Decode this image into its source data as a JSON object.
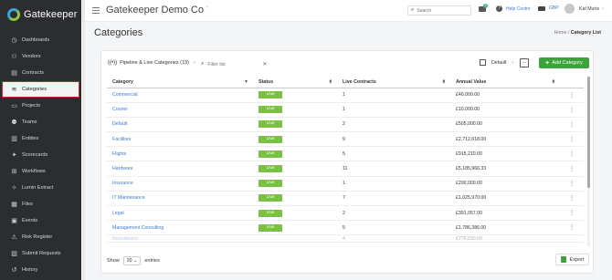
{
  "app": {
    "logo_text": "Gatekeeper"
  },
  "sidebar": {
    "items": [
      {
        "label": "Dashboards",
        "icon": "gauge-icon",
        "glyph": "◷"
      },
      {
        "label": "Vendors",
        "icon": "vendors-icon",
        "glyph": "⚇"
      },
      {
        "label": "Contracts",
        "icon": "document-icon",
        "glyph": "▤"
      },
      {
        "label": "Categories",
        "icon": "layers-icon",
        "glyph": "≋",
        "active": true
      },
      {
        "label": "Projects",
        "icon": "folder-icon",
        "glyph": "▭"
      },
      {
        "label": "Teams",
        "icon": "users-icon",
        "glyph": "⚉"
      },
      {
        "label": "Entities",
        "icon": "building-icon",
        "glyph": "▥"
      },
      {
        "label": "Scorecards",
        "icon": "star-icon",
        "glyph": "✦"
      },
      {
        "label": "Workflows",
        "icon": "workflow-icon",
        "glyph": "⊞"
      },
      {
        "label": "Lumin Extract",
        "icon": "sparkle-icon",
        "glyph": "✧"
      },
      {
        "label": "Files",
        "icon": "file-icon",
        "glyph": "▦"
      },
      {
        "label": "Events",
        "icon": "calendar-icon",
        "glyph": "▣"
      },
      {
        "label": "Risk Register",
        "icon": "warning-icon",
        "glyph": "⚠"
      },
      {
        "label": "Submit Requests",
        "icon": "submit-icon",
        "glyph": "▧"
      },
      {
        "label": "History",
        "icon": "history-icon",
        "glyph": "↺"
      }
    ]
  },
  "topbar": {
    "org": "Gatekeeper Demo Co",
    "search_placeholder": "Search",
    "mail_count": "3",
    "help": "Help Centre",
    "currency": "GBP",
    "user": "Kat Murie"
  },
  "page": {
    "title": "Categories",
    "breadcrumb_home": "Home",
    "breadcrumb_sep": "/",
    "breadcrumb_current": "Category List"
  },
  "toolbar": {
    "pipeline": "Pipeline & Live Categories (13)",
    "filter_placeholder": "Filter list",
    "view": "Default",
    "add_label": "Add Category"
  },
  "table": {
    "columns": [
      "Category",
      "Status",
      "Live Contracts",
      "Annual Value"
    ],
    "rows": [
      {
        "category": "Commercial",
        "status": "Live",
        "contracts": "1",
        "value": "£40,000.00"
      },
      {
        "category": "Courier",
        "status": "Live",
        "contracts": "1",
        "value": "£10,000.00"
      },
      {
        "category": "Default",
        "status": "Live",
        "contracts": "2",
        "value": "£505,000.00"
      },
      {
        "category": "Facilities",
        "status": "Live",
        "contracts": "9",
        "value": "£2,712,618.00"
      },
      {
        "category": "Flights",
        "status": "Live",
        "contracts": "5",
        "value": "£915,210.00"
      },
      {
        "category": "Hardware",
        "status": "Live",
        "contracts": "11",
        "value": "£5,185,966.33"
      },
      {
        "category": "Insurance",
        "status": "Live",
        "contracts": "1",
        "value": "£200,000.00"
      },
      {
        "category": "IT Maintenance",
        "status": "Live",
        "contracts": "7",
        "value": "£1,025,970.00"
      },
      {
        "category": "Legal",
        "status": "Live",
        "contracts": "2",
        "value": "£391,057.00"
      },
      {
        "category": "Management Consulting",
        "status": "Live",
        "contracts": "5",
        "value": "£1,786,386.00"
      }
    ],
    "partial_row": {
      "category": "Recruitment",
      "contracts": "4",
      "value": "£776,030.00"
    }
  },
  "footer": {
    "show_label": "Show",
    "page_size": "20",
    "entries_label": "entries",
    "export_label": "Export"
  }
}
